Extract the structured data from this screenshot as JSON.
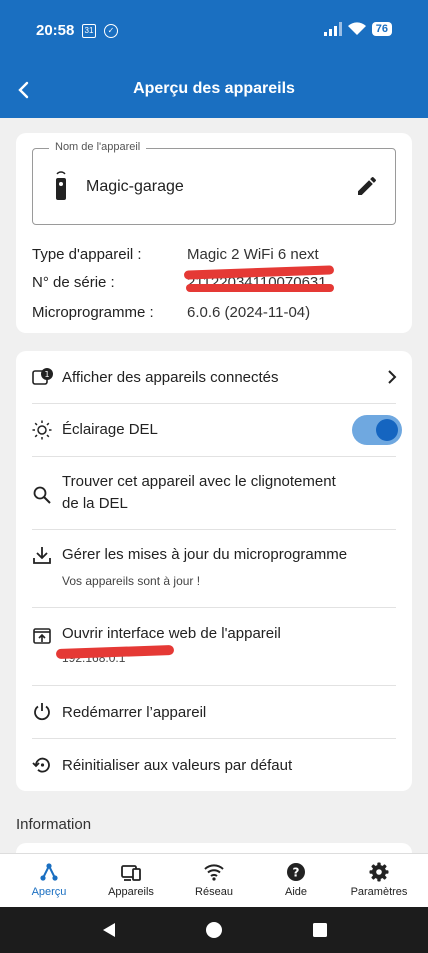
{
  "status": {
    "time": "20:58",
    "calendar_icon": "31",
    "battery": "76"
  },
  "appbar": {
    "title": "Aperçu des appareils"
  },
  "device": {
    "field_label": "Nom de l'appareil",
    "name": "Magic-garage",
    "type_label": "Type d'appareil :",
    "type_value": "Magic 2 WiFi 6 next",
    "serial_label": "N° de série :",
    "serial_value": "21122034110070631",
    "firmware_label": "Microprogramme :",
    "firmware_value": "6.0.6 (2024-11-04)"
  },
  "menu": {
    "connected": {
      "label": "Afficher des appareils connectés",
      "badge": "1"
    },
    "led": {
      "label": "Éclairage DEL",
      "enabled": true
    },
    "find": {
      "label_line1": "Trouver cet appareil avec le clignotement",
      "label_line2": "de la DEL"
    },
    "updates": {
      "label": "Gérer les mises à jour du microprogramme",
      "sub": "Vos appareils sont à jour !"
    },
    "web": {
      "label": "Ouvrir interface web de l'appareil",
      "sub": "192.168.0.1"
    },
    "restart": {
      "label": "Redémarrer l’appareil"
    },
    "reset": {
      "label": "Réinitialiser aux valeurs par défaut"
    }
  },
  "section": {
    "information": "Information"
  },
  "nav": [
    {
      "label": "Aperçu",
      "icon": "overview-icon"
    },
    {
      "label": "Appareils",
      "icon": "devices-icon"
    },
    {
      "label": "Réseau",
      "icon": "wifi-icon"
    },
    {
      "label": "Aide",
      "icon": "help-icon"
    },
    {
      "label": "Paramètres",
      "icon": "gear-icon"
    }
  ],
  "colors": {
    "brand": "#1a6fc1",
    "redaction": "#e53935",
    "toggle_on": "#1565c0"
  }
}
